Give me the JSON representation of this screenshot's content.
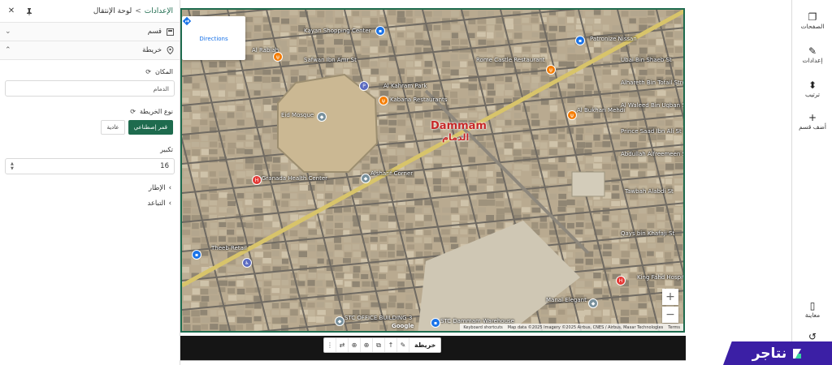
{
  "panel": {
    "breadcrumb_root": "الإعدادات",
    "breadcrumb_current": "لوحة الإنتقال",
    "section_label": "قسم",
    "map_section_label": "خريطة",
    "location_label": "المكان",
    "location_value": "الدمام",
    "map_type_label": "نوع الخريطة",
    "map_type_options": [
      "قمر إصطناعي",
      "عادية"
    ],
    "zoom_label": "تكبير",
    "zoom_value": "16",
    "frame_label": "الإطار",
    "spacing_label": "التباعد"
  },
  "map": {
    "directions_label": "Directions",
    "city_name_en": "Dammam",
    "city_name_ar": "الدمام",
    "places": [
      "Kayan Shopping Center",
      "Al Rabiah",
      "Safwan Ibn Amr St",
      "Al Kahram Park",
      "Kabana Restaurants",
      "Eid Mosque",
      "Granada Health Center",
      "Alsharif Corner",
      "Rome Castle Restaurant",
      "Al Bukhari Mehdi",
      "Prince Saad Ibn Ali St",
      "Abdullah Alfreemeen St",
      "Tawbah Alabdi St",
      "Qays bin Khafaji St",
      "King Fahd Hospital",
      "Manal Elegant",
      "Theeb Retail",
      "STC OFFICE BUILDING 3",
      "STC Dammam Warehouse",
      "Ubai Bin Shaeb St",
      "Alhareth Bin Tofail Street",
      "Al Waleed Bin Uqban Street",
      "Patronize Nissan"
    ],
    "footer": [
      "Keyboard shortcuts",
      "Map data ©2025 Imagery ©2025 Airbus, CNES / Airbus, Maxar Technologies",
      "Terms"
    ],
    "google_logo": "Google",
    "zoom_in": "+",
    "zoom_out": "−"
  },
  "toolbar": {
    "label": "خريطة"
  },
  "sidebar": {
    "items": [
      {
        "label": "الصفحات",
        "icon": "pages-icon"
      },
      {
        "label": "إعدادات",
        "icon": "pencil-icon"
      },
      {
        "label": "ترتيب",
        "icon": "sort-icon"
      },
      {
        "label": "أضف قسم",
        "icon": "plus-icon"
      },
      {
        "label": "معاينة",
        "icon": "mobile-icon"
      }
    ]
  },
  "brand": {
    "name": "نتاجر"
  }
}
